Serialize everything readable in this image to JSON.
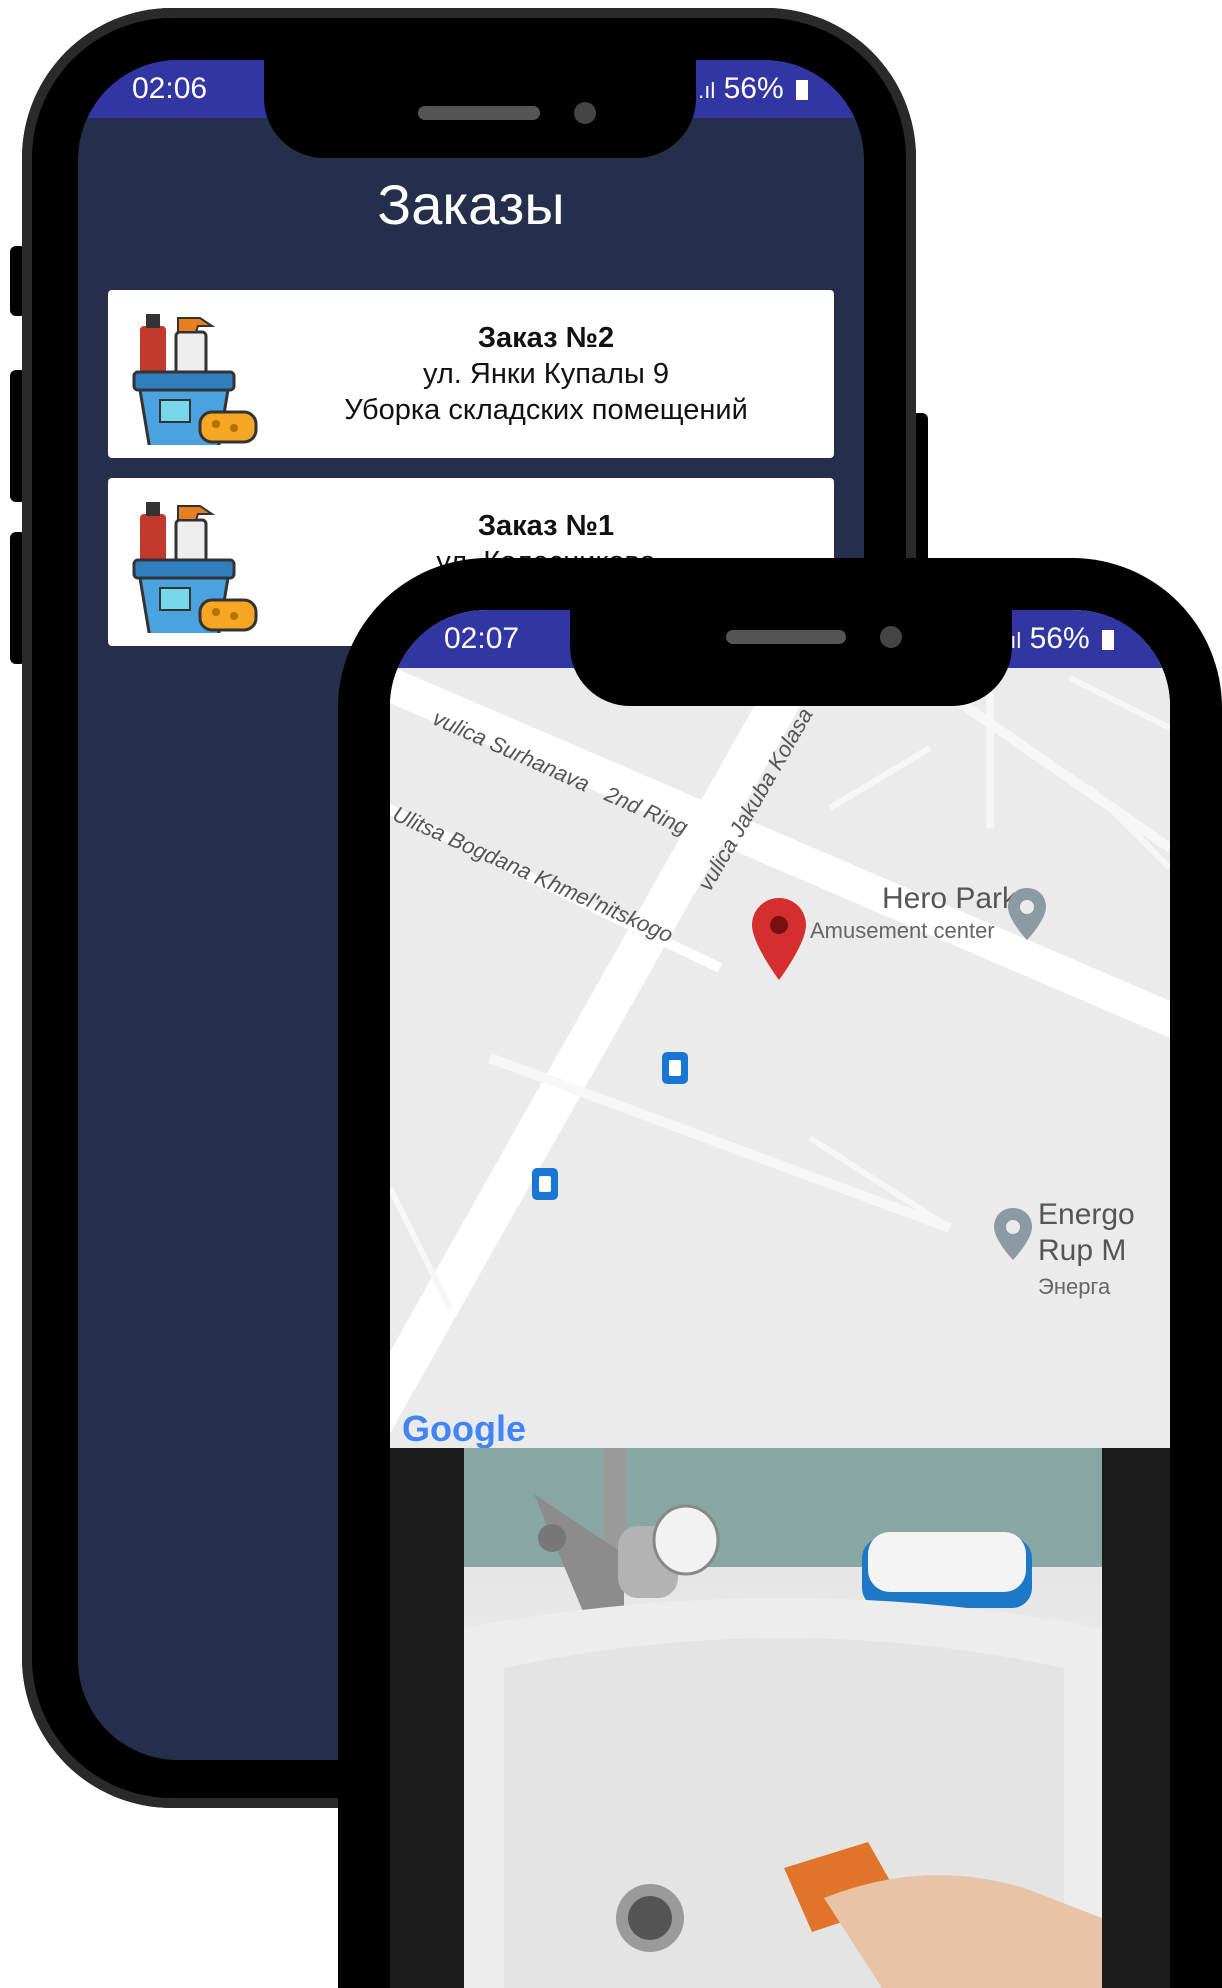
{
  "phone_back": {
    "status": {
      "time": "02:06",
      "battery": "56%"
    },
    "title": "Заказы",
    "orders": [
      {
        "title": "Заказ №2",
        "address": "ул. Янки Купалы 9",
        "description": "Уборка складских помещений"
      },
      {
        "title": "Заказ №1",
        "address": "ул. Колесникова",
        "description": ""
      }
    ]
  },
  "phone_front": {
    "status": {
      "time": "02:07",
      "battery": "56%"
    },
    "map": {
      "streets": [
        "vulica Surhanava",
        "2nd Ring",
        "Ulitsa Bogdana Khmel'nitskogo",
        "vulica Jakuba Kolasa"
      ],
      "pois": [
        {
          "name": "Hero Park",
          "category": "Amusement center"
        },
        {
          "name": "Energo",
          "line2": "Rup M",
          "sub": "Энерга"
        }
      ],
      "attribution": "Google"
    }
  },
  "colors": {
    "status_bar": "#3136a3",
    "screen_bg": "#252f4b",
    "map_pin": "#d32f2f"
  }
}
